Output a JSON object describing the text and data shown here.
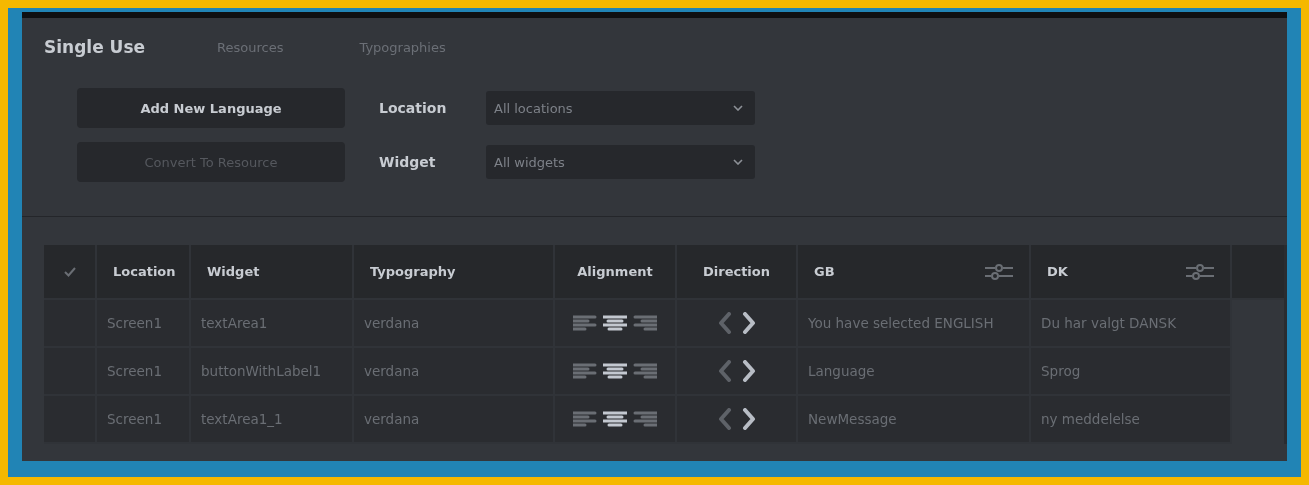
{
  "tabs": [
    {
      "label": "Single Use",
      "selected": true
    },
    {
      "label": "Resources",
      "selected": false
    },
    {
      "label": "Typographies",
      "selected": false
    }
  ],
  "buttons": [
    {
      "label": "Add New Language",
      "disabled": false
    },
    {
      "label": "Convert To Resource",
      "disabled": true
    }
  ],
  "filters": [
    {
      "label": "Location",
      "value": "All locations"
    },
    {
      "label": "Widget",
      "value": "All widgets"
    }
  ],
  "table": {
    "columns": [
      "Location",
      "Widget",
      "Typography",
      "Alignment",
      "Direction",
      "GB",
      "DK"
    ],
    "rows": [
      {
        "location": "Screen1",
        "widget": "textArea1",
        "typography": "verdana",
        "alignment": [
          {
            "kind": "left",
            "selected": false
          },
          {
            "kind": "center",
            "selected": true
          },
          {
            "kind": "right",
            "selected": false
          }
        ],
        "direction": [
          {
            "kind": "left",
            "selected": false
          },
          {
            "kind": "right",
            "selected": true
          }
        ],
        "gb": "You have selected ENGLISH",
        "dk": "Du har valgt DANSK"
      },
      {
        "location": "Screen1",
        "widget": "buttonWithLabel1",
        "typography": "verdana",
        "alignment": [
          {
            "kind": "left",
            "selected": false
          },
          {
            "kind": "center",
            "selected": true
          },
          {
            "kind": "right",
            "selected": false
          }
        ],
        "direction": [
          {
            "kind": "left",
            "selected": false
          },
          {
            "kind": "right",
            "selected": true
          }
        ],
        "gb": "Language",
        "dk": "Sprog"
      },
      {
        "location": "Screen1",
        "widget": "textArea1_1",
        "typography": "verdana",
        "alignment": [
          {
            "kind": "left",
            "selected": false
          },
          {
            "kind": "center",
            "selected": true
          },
          {
            "kind": "right",
            "selected": false
          }
        ],
        "direction": [
          {
            "kind": "left",
            "selected": false
          },
          {
            "kind": "right",
            "selected": true
          }
        ],
        "gb": "NewMessage",
        "dk": "ny meddelelse"
      }
    ]
  }
}
